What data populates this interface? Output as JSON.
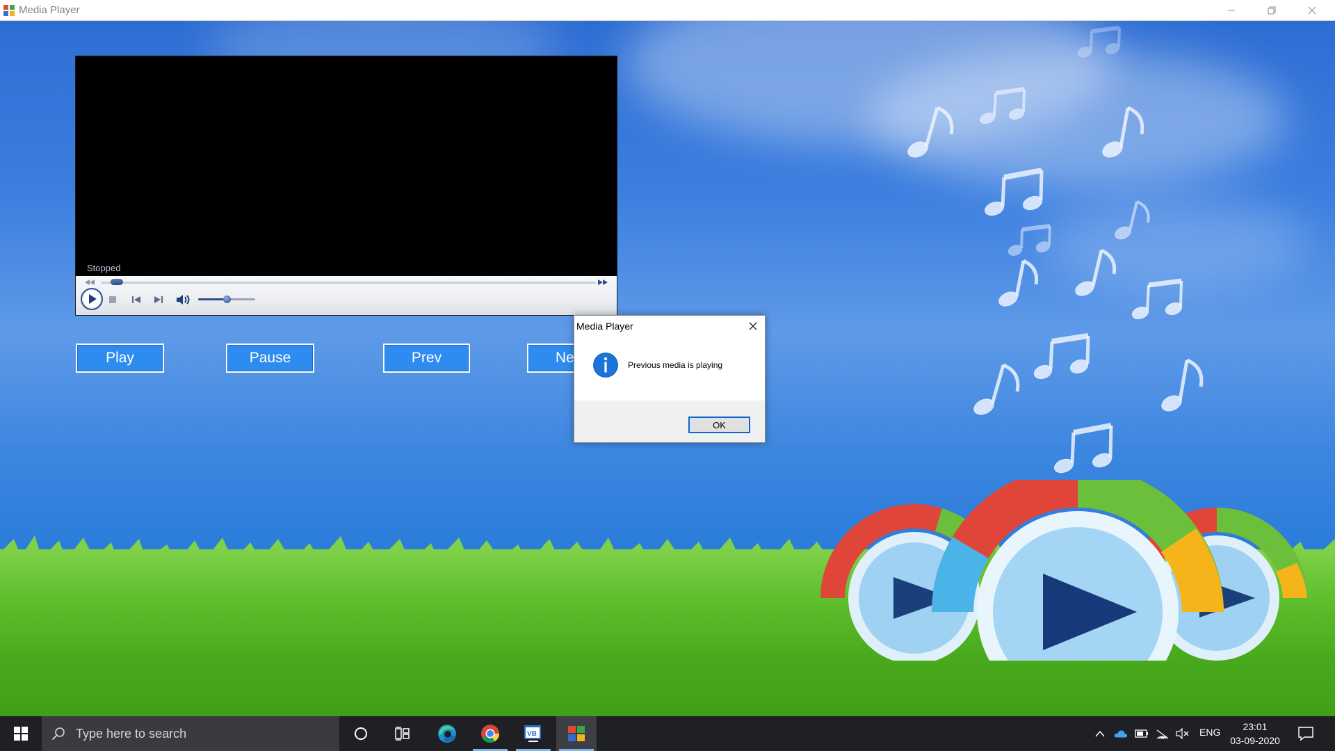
{
  "window": {
    "title": "Media Player",
    "icon": "media-player-app-icon",
    "controls": [
      "minimize-icon",
      "restore-icon",
      "close-icon"
    ]
  },
  "player": {
    "status": "Stopped",
    "seek_fraction": 0.02,
    "volume_fraction": 0.5,
    "icons": [
      "rewind-icon",
      "fast-forward-icon",
      "play-icon",
      "stop-icon",
      "previous-track-icon",
      "next-track-icon",
      "volume-icon"
    ]
  },
  "buttons": {
    "play": "Play",
    "pause": "Pause",
    "prev": "Prev",
    "next": "Next"
  },
  "dialog": {
    "title": "Media Player",
    "message": "Previous media is playing",
    "ok": "OK",
    "icon": "info-icon"
  },
  "taskbar": {
    "search_placeholder": "Type here to search",
    "apps": [
      "cortana-icon",
      "task-view-icon",
      "edge-icon",
      "chrome-icon",
      "visual-studio-icon",
      "media-player-app-icon"
    ],
    "tray": {
      "language": "ENG",
      "time": "23:01",
      "date": "03-09-2020",
      "icons": [
        "chevron-up-icon",
        "onedrive-icon",
        "battery-icon",
        "wifi-icon",
        "volume-muted-icon",
        "notification-icon"
      ]
    }
  },
  "colors": {
    "button_blue": "#2e8bf0",
    "taskbar": "#1f2024",
    "sky_blue": "#3c7fe0",
    "grass_green": "#5fbf2c",
    "dialog_accent": "#0a66d1"
  }
}
